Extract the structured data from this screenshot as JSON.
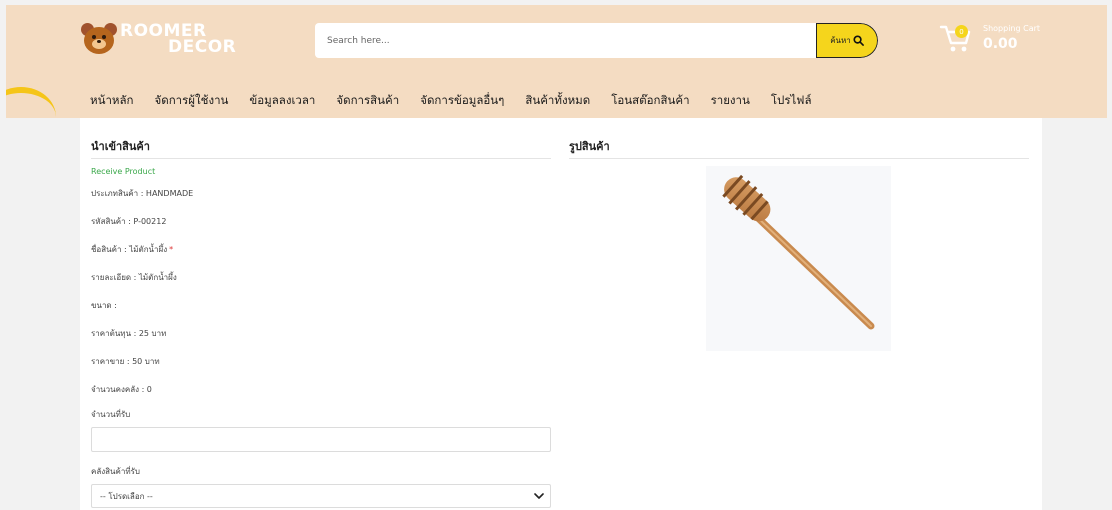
{
  "brand": {
    "line1": "ROOMER",
    "line2": "DECOR"
  },
  "search": {
    "placeholder": "Search here...",
    "button_label": "ค้นหา"
  },
  "cart": {
    "title": "Shopping Cart",
    "amount": "0.00",
    "badge": "0"
  },
  "nav": {
    "items": [
      "หน้าหลัก",
      "จัดการผู้ใช้งาน",
      "ข้อมูลลงเวลา",
      "จัดการสินค้า",
      "จัดการข้อมูลอื่นๆ",
      "สินค้าทั้งหมด",
      "โอนสต๊อกสินค้า",
      "รายงาน",
      "โปรไฟล์"
    ]
  },
  "form": {
    "section_title": "นำเข้าสินค้า",
    "subtitle": "Receive Product",
    "fields": [
      "ประเภทสินค้า : HANDMADE",
      "รหัสสินค้า : P-00212",
      "ชื่อสินค้า : ไม้ตักน้ำผึ้ง",
      "รายละเอียด : ไม้ตักน้ำผึ้ง",
      "ขนาด :",
      "ราคาต้นทุน : 25 บาท",
      "ราคาขาย : 50 บาท",
      "จำนวนคงคลัง : 0"
    ],
    "required_mark": "*",
    "quantity_label": "จำนวนที่รับ",
    "quantity_value": "",
    "warehouse_label": "คลังสินค้าที่รับ",
    "warehouse_selected": "-- โปรดเลือก --"
  },
  "image_section": {
    "title": "รูปสินค้า"
  },
  "colors": {
    "header_bg": "#f4dcc2",
    "accent": "#f5d51c",
    "success": "#3aa84a",
    "required": "#dd3333"
  },
  "icons": {
    "search": "search-icon",
    "cart": "cart-icon",
    "chevron": "chevron-down-icon"
  }
}
